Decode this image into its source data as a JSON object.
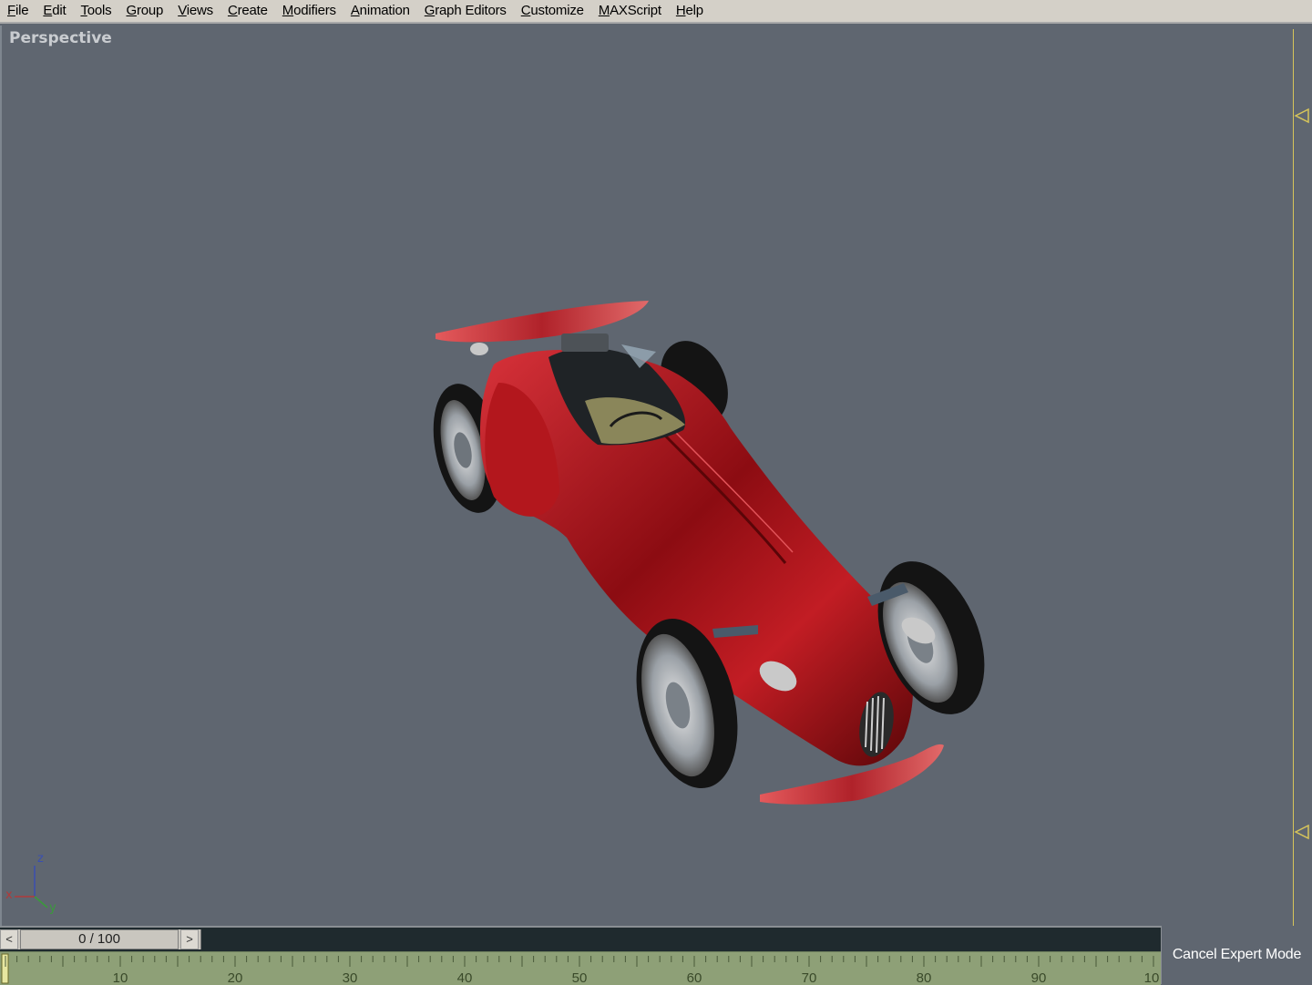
{
  "menubar": {
    "items": [
      "File",
      "Edit",
      "Tools",
      "Group",
      "Views",
      "Create",
      "Modifiers",
      "Animation",
      "Graph Editors",
      "Customize",
      "MAXScript",
      "Help"
    ]
  },
  "viewport": {
    "label": "Perspective",
    "background": "#5f6670",
    "model_color": "#b01a1a"
  },
  "axis_tripod": {
    "x_label": "x",
    "y_label": "y",
    "z_label": "z"
  },
  "time_slider": {
    "prev_icon": "left-arrow-icon",
    "next_icon": "right-arrow-icon",
    "prev_glyph": "<",
    "next_glyph": ">",
    "frame_display": "0 / 100"
  },
  "timeline": {
    "tick_labels": [
      "10",
      "20",
      "30",
      "40",
      "50",
      "60",
      "70",
      "80",
      "90",
      "10"
    ]
  },
  "cancel_expert_mode": {
    "label": "Cancel Expert Mode"
  }
}
